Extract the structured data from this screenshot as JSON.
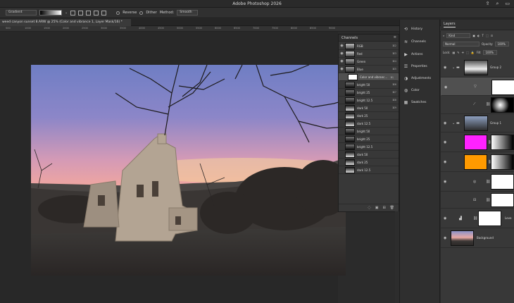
{
  "window": {
    "title": "Adobe Photoshop 2026"
  },
  "options_bar": {
    "tool_preset": "Gradient",
    "reverse_label": "Reverse",
    "dither_label": "Dither",
    "method_label": "Method:",
    "method_value": "Smooth"
  },
  "document": {
    "tab_title": "weed canyon sunset 8.ARW @ 25% (Color and vibrance 1, Layer Mask/16) *"
  },
  "ruler": {
    "ticks": [
      "500",
      "1000",
      "1500",
      "2000",
      "2500",
      "3000",
      "3500",
      "4000",
      "4500",
      "5000",
      "5500",
      "6000",
      "6500",
      "7000",
      "7500",
      "8000",
      "8500",
      "9000"
    ]
  },
  "channels": {
    "title": "Channels",
    "rows": [
      {
        "name": "RGB",
        "shortcut": "⌘2",
        "eye": true
      },
      {
        "name": "Red",
        "shortcut": "⌘3",
        "eye": true
      },
      {
        "name": "Green",
        "shortcut": "⌘4",
        "eye": true
      },
      {
        "name": "Blue",
        "shortcut": "⌘5",
        "eye": true
      },
      {
        "name": "Color and vibranc...",
        "shortcut": "⌘\\",
        "eye": false,
        "selected": true
      },
      {
        "name": "bright 50",
        "shortcut": "⌘6",
        "eye": false
      },
      {
        "name": "bright 25",
        "shortcut": "⌘7",
        "eye": false
      },
      {
        "name": "bright 12.5",
        "shortcut": "⌘8",
        "eye": false
      },
      {
        "name": "dark 50",
        "shortcut": "⌘9",
        "eye": false
      },
      {
        "name": "dark 25",
        "shortcut": "",
        "eye": false
      },
      {
        "name": "dark 12.5",
        "shortcut": "",
        "eye": false
      },
      {
        "name": "bright 50",
        "shortcut": "",
        "eye": false
      },
      {
        "name": "bright 25",
        "shortcut": "",
        "eye": false
      },
      {
        "name": "bright 12.5",
        "shortcut": "",
        "eye": false
      },
      {
        "name": "dark 50",
        "shortcut": "",
        "eye": false
      },
      {
        "name": "dark 25",
        "shortcut": "",
        "eye": false
      },
      {
        "name": "dark 12.5",
        "shortcut": "",
        "eye": false
      }
    ]
  },
  "dock": {
    "items": [
      {
        "label": "History",
        "icon": "history-icon"
      },
      {
        "label": "Channels",
        "icon": "channels-icon"
      },
      {
        "label": "Actions",
        "icon": "play-icon"
      },
      {
        "label": "Properties",
        "icon": "properties-icon"
      },
      {
        "label": "Adjustments",
        "icon": "adjustments-icon"
      },
      {
        "label": "Color",
        "icon": "color-icon"
      },
      {
        "label": "Swatches",
        "icon": "swatches-icon"
      }
    ],
    "highlight_color": "#dcd73c"
  },
  "layers": {
    "title": "Layers",
    "filter_label": "Kind",
    "blend_mode": "Normal",
    "opacity_label": "Opacity:",
    "opacity_value": "100%",
    "lock_label": "Lock:",
    "fill_label": "Fill:",
    "fill_value": "100%",
    "rows": [
      {
        "name": "Group 2"
      },
      {
        "name": ""
      },
      {
        "name": ""
      },
      {
        "name": "Group 1"
      },
      {
        "name": ""
      },
      {
        "name": ""
      },
      {
        "name": ""
      },
      {
        "name": "Leve"
      },
      {
        "name": "Background"
      }
    ],
    "mask_colors": {
      "magenta": "#ff22ff",
      "orange": "#ff9a00"
    }
  }
}
